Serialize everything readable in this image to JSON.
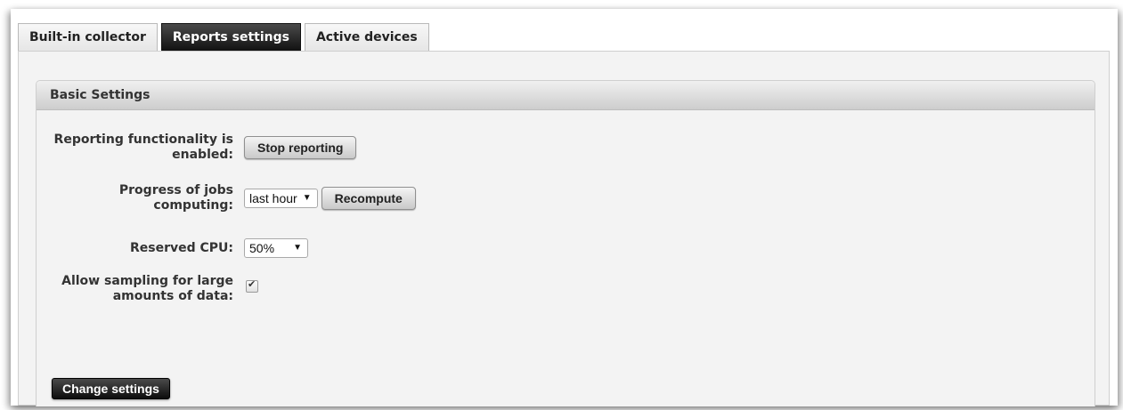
{
  "tabs": [
    {
      "label": "Built-in collector",
      "active": false
    },
    {
      "label": "Reports settings",
      "active": true
    },
    {
      "label": "Active devices",
      "active": false
    }
  ],
  "panel": {
    "title": "Basic Settings",
    "rows": {
      "reporting": {
        "label_line1": "Reporting functionality is",
        "label_line2": "enabled:",
        "button": "Stop reporting"
      },
      "progress": {
        "label_line1": "Progress of jobs",
        "label_line2": "computing:",
        "select_value": "last hour",
        "button": "Recompute"
      },
      "cpu": {
        "label": "Reserved CPU:",
        "select_value": "50%"
      },
      "sampling": {
        "label_line1": "Allow sampling for large",
        "label_line2": "amounts of data:",
        "checked": true
      }
    },
    "submit_label": "Change settings"
  },
  "colors": {
    "active_tab": "#1a1a1a",
    "panel_bg": "#f3f3f3",
    "dark_button": "#111111"
  },
  "icons": {
    "dropdown": "caret-down-icon",
    "check": "checkmark-icon"
  }
}
